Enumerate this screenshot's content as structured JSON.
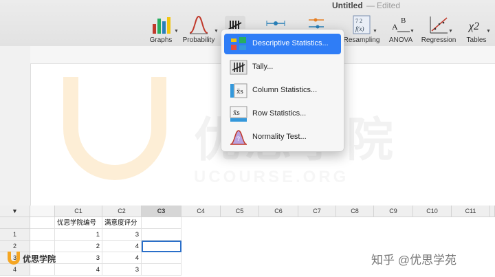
{
  "window": {
    "title": "Untitled",
    "separator": "—",
    "status": "Edited"
  },
  "toolbar": {
    "tools": [
      {
        "label": "Graphs",
        "icon": "bar-chart-icon"
      },
      {
        "label": "Probability",
        "icon": "bell-curve-icon"
      },
      {
        "label": "",
        "icon": "tally-icon"
      },
      {
        "label": "",
        "icon": "dot-range-icon"
      },
      {
        "label": "",
        "icon": "dot-range-icon"
      },
      {
        "label": "Resampling",
        "icon": "resampling-icon"
      },
      {
        "label": "ANOVA",
        "icon": "anova-icon"
      },
      {
        "label": "Regression",
        "icon": "regression-icon"
      },
      {
        "label": "Tables",
        "icon": "chi-square-icon",
        "icon_text": "χ2"
      }
    ]
  },
  "menu": {
    "items": [
      {
        "label": "Descriptive Statistics...",
        "icon": "descriptive-stats-icon",
        "highlighted": true
      },
      {
        "label": "Tally...",
        "icon": "tally-icon"
      },
      {
        "label": "Column Statistics...",
        "icon": "column-stats-icon"
      },
      {
        "label": "Row Statistics...",
        "icon": "row-stats-icon"
      },
      {
        "label": "Normality Test...",
        "icon": "normality-test-icon"
      }
    ]
  },
  "watermark": {
    "chinese": "优思学院",
    "english": "UCOURSE.ORG"
  },
  "grid": {
    "columns": [
      "C1",
      "C2",
      "C3",
      "C4",
      "C5",
      "C6",
      "C7",
      "C8",
      "C9",
      "C10",
      "C11"
    ],
    "selected_column": "C3",
    "names": [
      "优思学院编号",
      "满意度评分"
    ],
    "rows": [
      {
        "n": "1",
        "c1": "1",
        "c2": "3"
      },
      {
        "n": "2",
        "c1": "2",
        "c2": "4"
      },
      {
        "n": "3",
        "c1": "3",
        "c2": "4"
      },
      {
        "n": "4",
        "c1": "4",
        "c2": "3"
      }
    ]
  },
  "footer": {
    "logo_text": "优思学院",
    "right_watermark": "知乎 @优思学苑"
  },
  "colors": {
    "accent": "#2f7df6",
    "selection": "#2a6fc9",
    "watermark_orange": "#f5a623"
  }
}
